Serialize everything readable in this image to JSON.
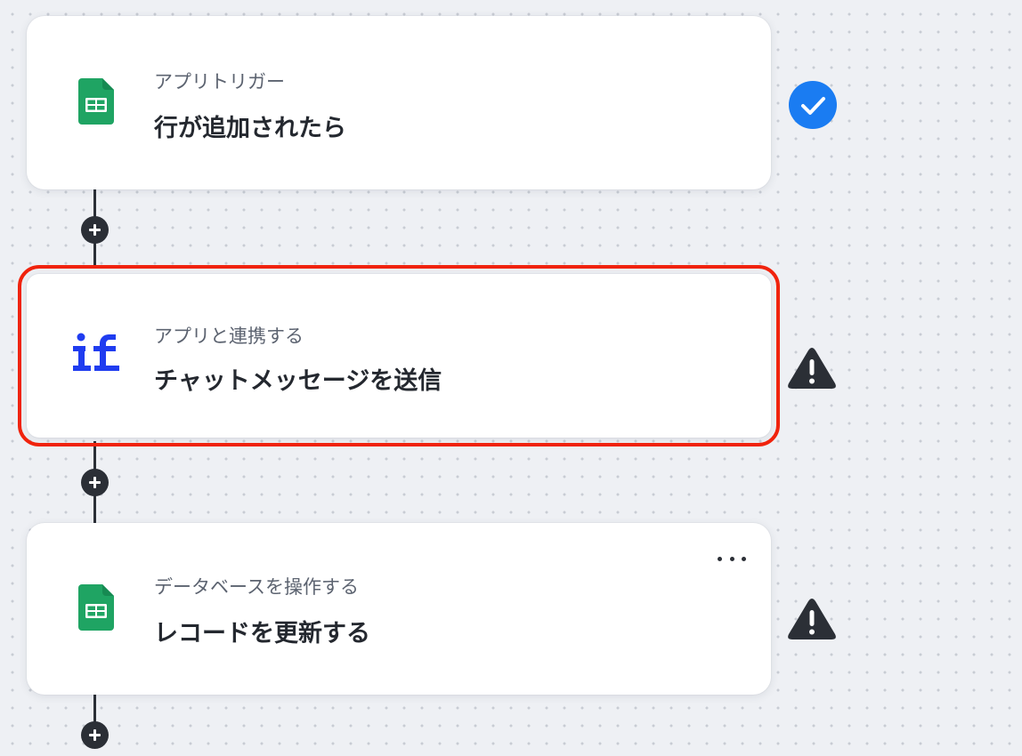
{
  "flow": {
    "steps": [
      {
        "app_icon": "google-sheets-icon",
        "subtitle": "アプリトリガー",
        "title": "行が追加されたら",
        "status": "completed",
        "status_icon": "check-circle-icon"
      },
      {
        "app_icon": "if-logo-icon",
        "subtitle": "アプリと連携する",
        "title": "チャットメッセージを送信",
        "status": "warning",
        "status_icon": "warning-icon",
        "selected": true
      },
      {
        "app_icon": "google-sheets-icon",
        "subtitle": "データベースを操作する",
        "title": "レコードを更新する",
        "status": "warning",
        "status_icon": "warning-icon",
        "more_icon": "more-dots-icon"
      }
    ],
    "add_step_icon": "plus-icon"
  },
  "colors": {
    "selection_outline": "#f0230d",
    "check_blue": "#1a7cf2",
    "warning_dark": "#2b2f36",
    "sheets_green": "#1fa463",
    "if_logo_blue": "#1f3cf0"
  }
}
